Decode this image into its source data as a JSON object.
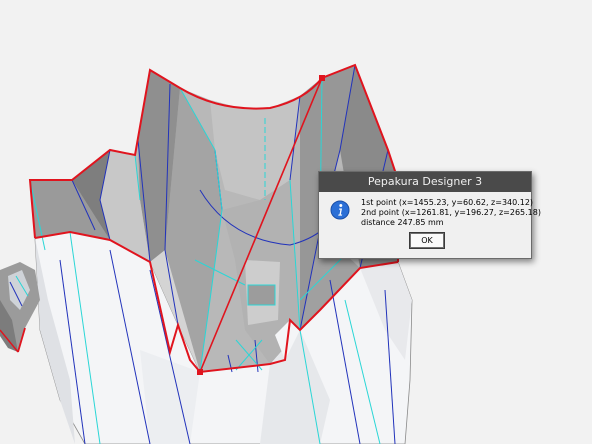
{
  "dialog": {
    "title": "Pepakura Designer 3",
    "icon": "info-icon",
    "lines": [
      "1st point (x=1455.23, y=60.62, z=340.12)",
      "2nd point (x=1261.81, y=196.27, z=265.18)",
      "distance 247.85 mm"
    ],
    "ok_label": "OK"
  },
  "colors": {
    "background": "#f2f2f2",
    "edge_red": "#e0141e",
    "fold_cyan": "#2ad6d6",
    "fold_blue": "#2233bb",
    "face_gray": "#a9a9a9",
    "face_white": "#f4f5f7",
    "titlebar": "#4a4a4a"
  }
}
